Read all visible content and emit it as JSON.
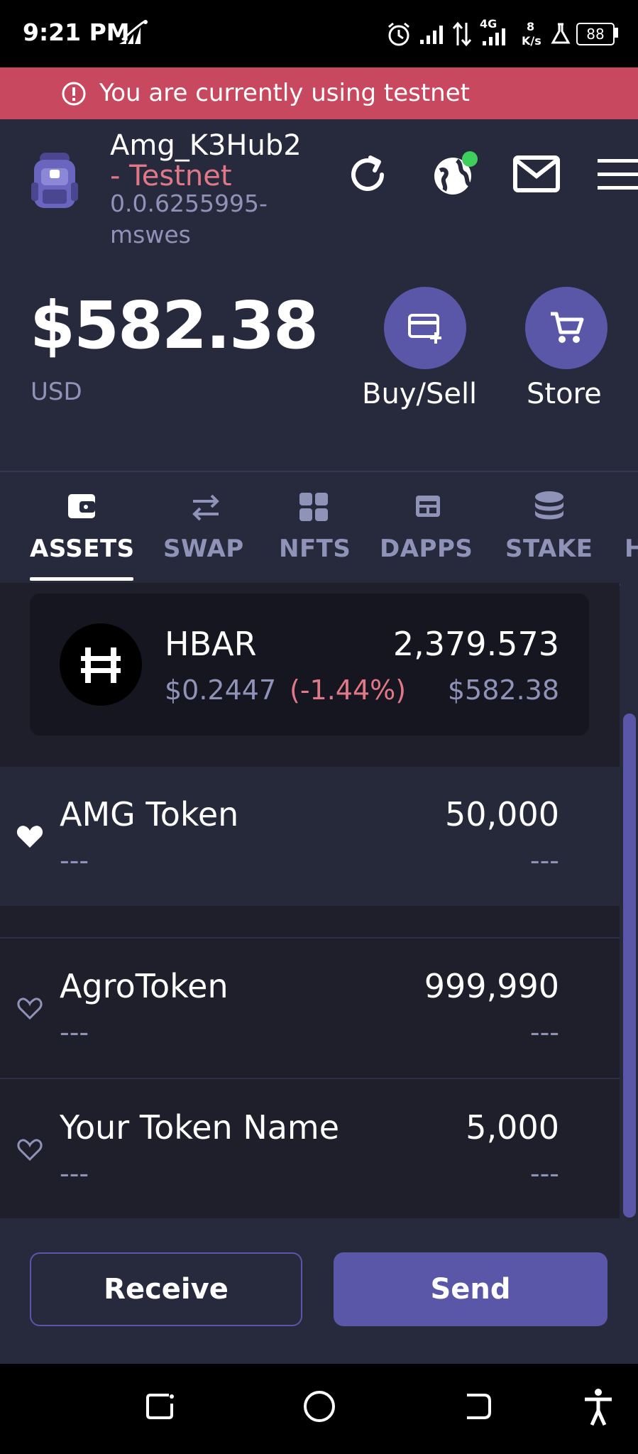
{
  "status_bar": {
    "time": "9:21 PM",
    "battery": "88",
    "speed_value": "8",
    "speed_unit": "K/s",
    "network_label": "4G"
  },
  "banner": {
    "text": "You are currently using testnet"
  },
  "header": {
    "account_name": "Amg_K3Hub2",
    "network": "- Testnet",
    "account_id": "0.0.6255995-mswes"
  },
  "balance": {
    "amount": "$582.38",
    "currency": "USD"
  },
  "actions": {
    "buy_sell": "Buy/Sell",
    "store": "Store"
  },
  "tabs": [
    {
      "label": "ASSETS",
      "active": true
    },
    {
      "label": "SWAP"
    },
    {
      "label": "NFTS"
    },
    {
      "label": "DAPPS"
    },
    {
      "label": "STAKE"
    },
    {
      "label": "H"
    }
  ],
  "hbar": {
    "symbol": "HBAR",
    "price": "$0.2447",
    "change": "(-1.44%)",
    "amount": "2,379.573",
    "value": "$582.38"
  },
  "tokens": [
    {
      "name": "AMG Token",
      "amount": "50,000",
      "sub": "---",
      "value": "---",
      "favorite": true
    },
    {
      "name": "AgroToken",
      "amount": "999,990",
      "sub": "---",
      "value": "---",
      "favorite": false
    },
    {
      "name": "Your Token Name",
      "amount": "5,000",
      "sub": "---",
      "value": "---",
      "favorite": false
    }
  ],
  "buttons": {
    "receive": "Receive",
    "send": "Send"
  },
  "colors": {
    "accent": "#5a57a8",
    "banner": "#c8495f",
    "negative": "#e07888",
    "background": "#272a3c",
    "online_dot": "#3fcf5c"
  }
}
